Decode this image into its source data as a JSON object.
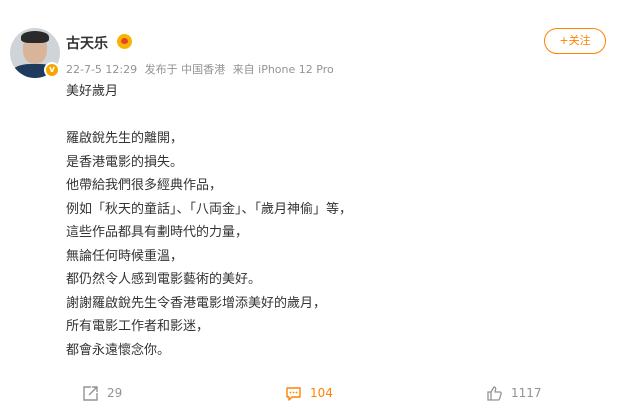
{
  "post": {
    "author": "古天乐",
    "meta": {
      "time": "22-7-5 12:29",
      "location": "发布于 中国香港",
      "source": "来自 iPhone 12 Pro"
    },
    "follow_label": "+关注",
    "content_lines": [
      "美好歲月",
      "",
      "羅啟銳先生的離開，",
      "是香港電影的損失。",
      "他帶給我們很多經典作品，",
      "例如「秋天的童話」、「八両金」、「歲月神偷」等，",
      "這些作品都具有劃時代的力量，",
      "無論任何時候重溫，",
      "都仍然令人感到電影藝術的美好。",
      "謝謝羅啟銳先生令香港電影增添美好的歲月，",
      "所有電影工作者和影迷，",
      "都會永遠懷念你。"
    ],
    "actions": {
      "repost_count": "29",
      "comment_count": "104",
      "like_count": "1117"
    }
  },
  "icons": {
    "avatar": "avatar",
    "verified": "verified-badge-icon",
    "vip": "vip-icon",
    "repost": "repost-icon",
    "comment": "comment-icon",
    "like": "thumbs-up-icon"
  },
  "colors": {
    "accent": "#ff8200",
    "meta_text": "#939393",
    "body_text": "#333333",
    "badge": "#f7a600"
  }
}
